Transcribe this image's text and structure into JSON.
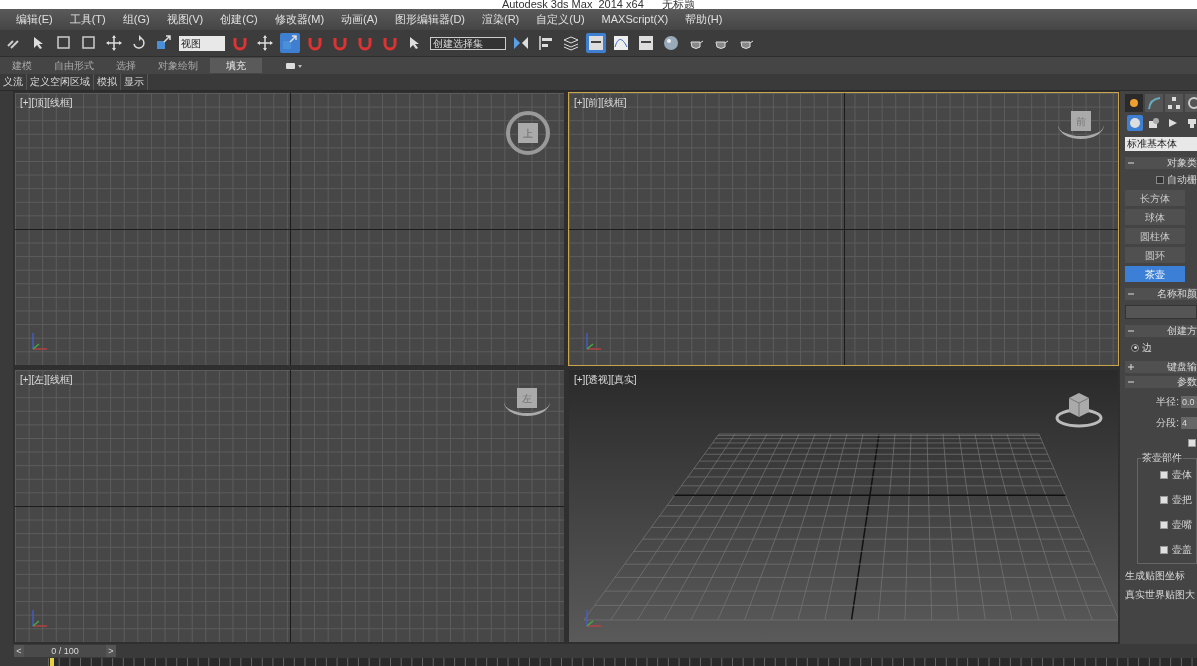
{
  "window": {
    "title": "Autodesk 3ds Max  2014 x64      无标题"
  },
  "menu": [
    "编辑(E)",
    "工具(T)",
    "组(G)",
    "视图(V)",
    "创建(C)",
    "修改器(M)",
    "动画(A)",
    "图形编辑器(D)",
    "渲染(R)",
    "自定义(U)",
    "MAXScript(X)",
    "帮助(H)"
  ],
  "toolbar": {
    "view_dropdown": "视图",
    "selection_set_dropdown": "创建选择集"
  },
  "ribbon_tabs": [
    {
      "label": "建模",
      "selected": false
    },
    {
      "label": "自由形式",
      "selected": false
    },
    {
      "label": "选择",
      "selected": false
    },
    {
      "label": "对象绘制",
      "selected": false
    },
    {
      "label": "填充",
      "selected": true
    }
  ],
  "ribbon_panels": [
    "义流",
    "定义空闲区域",
    "模拟",
    "显示"
  ],
  "viewports": [
    {
      "label": "[+][顶][线框]",
      "kind": "top",
      "cube_label": "上",
      "active": false
    },
    {
      "label": "[+][前][线框]",
      "kind": "side",
      "cube_label": "前",
      "active": true
    },
    {
      "label": "[+][左][线框]",
      "kind": "side",
      "cube_label": "左",
      "active": false
    },
    {
      "label": "[+][透视][真实]",
      "kind": "perspective",
      "active": false
    }
  ],
  "command_panel": {
    "tabs": [
      {
        "selected": true
      },
      {
        "selected": false
      },
      {
        "selected": false
      },
      {
        "selected": false
      }
    ],
    "categories": [
      {
        "selected": true
      },
      {
        "selected": false
      },
      {
        "selected": false
      },
      {
        "selected": false
      }
    ],
    "category_dropdown": "标准基本体",
    "object_type": {
      "title": "对象类",
      "autogrid": {
        "label": "自动栅",
        "checked": false
      },
      "buttons": [
        {
          "label": "长方体",
          "selected": false
        },
        {
          "label": "球体",
          "selected": false
        },
        {
          "label": "圆柱体",
          "selected": false
        },
        {
          "label": "圆环",
          "selected": false
        },
        {
          "label": "茶壶",
          "selected": true
        }
      ]
    },
    "name_color": {
      "title": "名称和颜"
    },
    "creation_method": {
      "title": "创建方",
      "option": {
        "label": "边",
        "selected": true
      }
    },
    "keyboard_entry": {
      "title": "键盘输",
      "expanded": false
    },
    "parameters": {
      "title": "参数",
      "expanded": true,
      "radius_label": "半径:",
      "radius": "0.0",
      "segments_label": "分段:",
      "segments": "4",
      "smooth": {
        "checked": true
      },
      "parts_title": "茶壶部件",
      "parts": [
        {
          "label": "壶体",
          "checked": true
        },
        {
          "label": "壶把",
          "checked": true
        },
        {
          "label": "壶嘴",
          "checked": true
        },
        {
          "label": "壶盖",
          "checked": true
        }
      ],
      "mapping": [
        "生成贴图坐标",
        "真实世界贴图大"
      ]
    }
  },
  "time_slider": {
    "prev": "<",
    "label": "0 / 100",
    "next": ">",
    "level": 0
  }
}
